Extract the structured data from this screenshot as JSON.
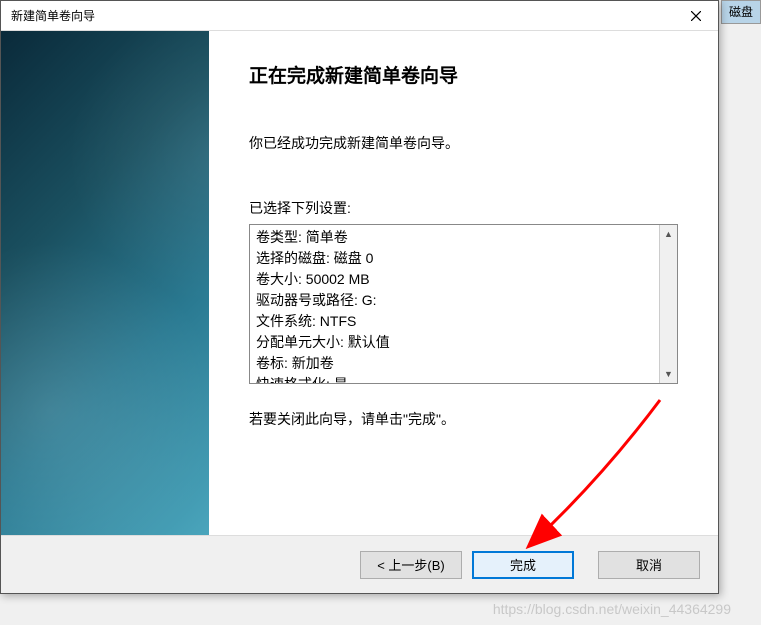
{
  "background": {
    "tab_label": "磁盘"
  },
  "titlebar": {
    "text": "新建简单卷向导"
  },
  "main": {
    "heading": "正在完成新建简单卷向导",
    "desc": "你已经成功完成新建简单卷向导。",
    "settings_label": "已选择下列设置:",
    "settings_lines": [
      "卷类型: 简单卷",
      "选择的磁盘: 磁盘 0",
      "卷大小: 50002 MB",
      "驱动器号或路径: G:",
      "文件系统: NTFS",
      "分配单元大小: 默认值",
      "卷标: 新加卷",
      "快速格式化: 是"
    ],
    "close_hint": "若要关闭此向导，请单击\"完成\"。"
  },
  "footer": {
    "back": "< 上一步(B)",
    "finish": "完成",
    "cancel": "取消"
  },
  "watermark": "https://blog.csdn.net/weixin_44364299"
}
